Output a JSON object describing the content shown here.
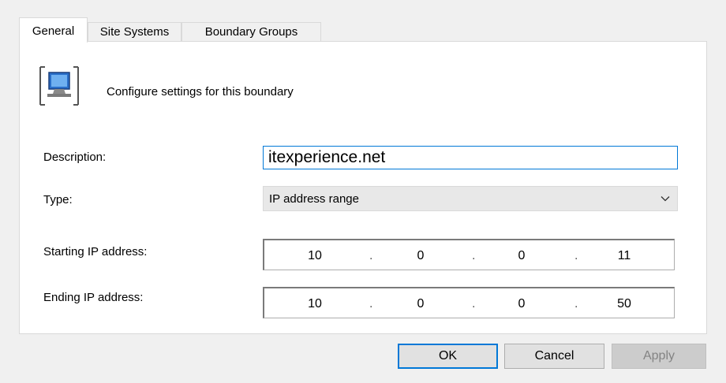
{
  "tabs": [
    {
      "label": "General",
      "active": true
    },
    {
      "label": "Site Systems",
      "active": false
    },
    {
      "label": "Boundary Groups",
      "active": false
    }
  ],
  "header": {
    "icon": "boundary-computer-icon",
    "text": "Configure settings for this boundary"
  },
  "form": {
    "description_label": "Description:",
    "description_value": "itexperience.net",
    "type_label": "Type:",
    "type_value": "IP address range",
    "start_label": "Starting IP address:",
    "start_ip": [
      "10",
      "0",
      "0",
      "11"
    ],
    "end_label": "Ending IP address:",
    "end_ip": [
      "10",
      "0",
      "0",
      "50"
    ]
  },
  "buttons": {
    "ok": "OK",
    "cancel": "Cancel",
    "apply": "Apply"
  },
  "colors": {
    "accent": "#0078d7",
    "disabled_text": "#838383"
  }
}
